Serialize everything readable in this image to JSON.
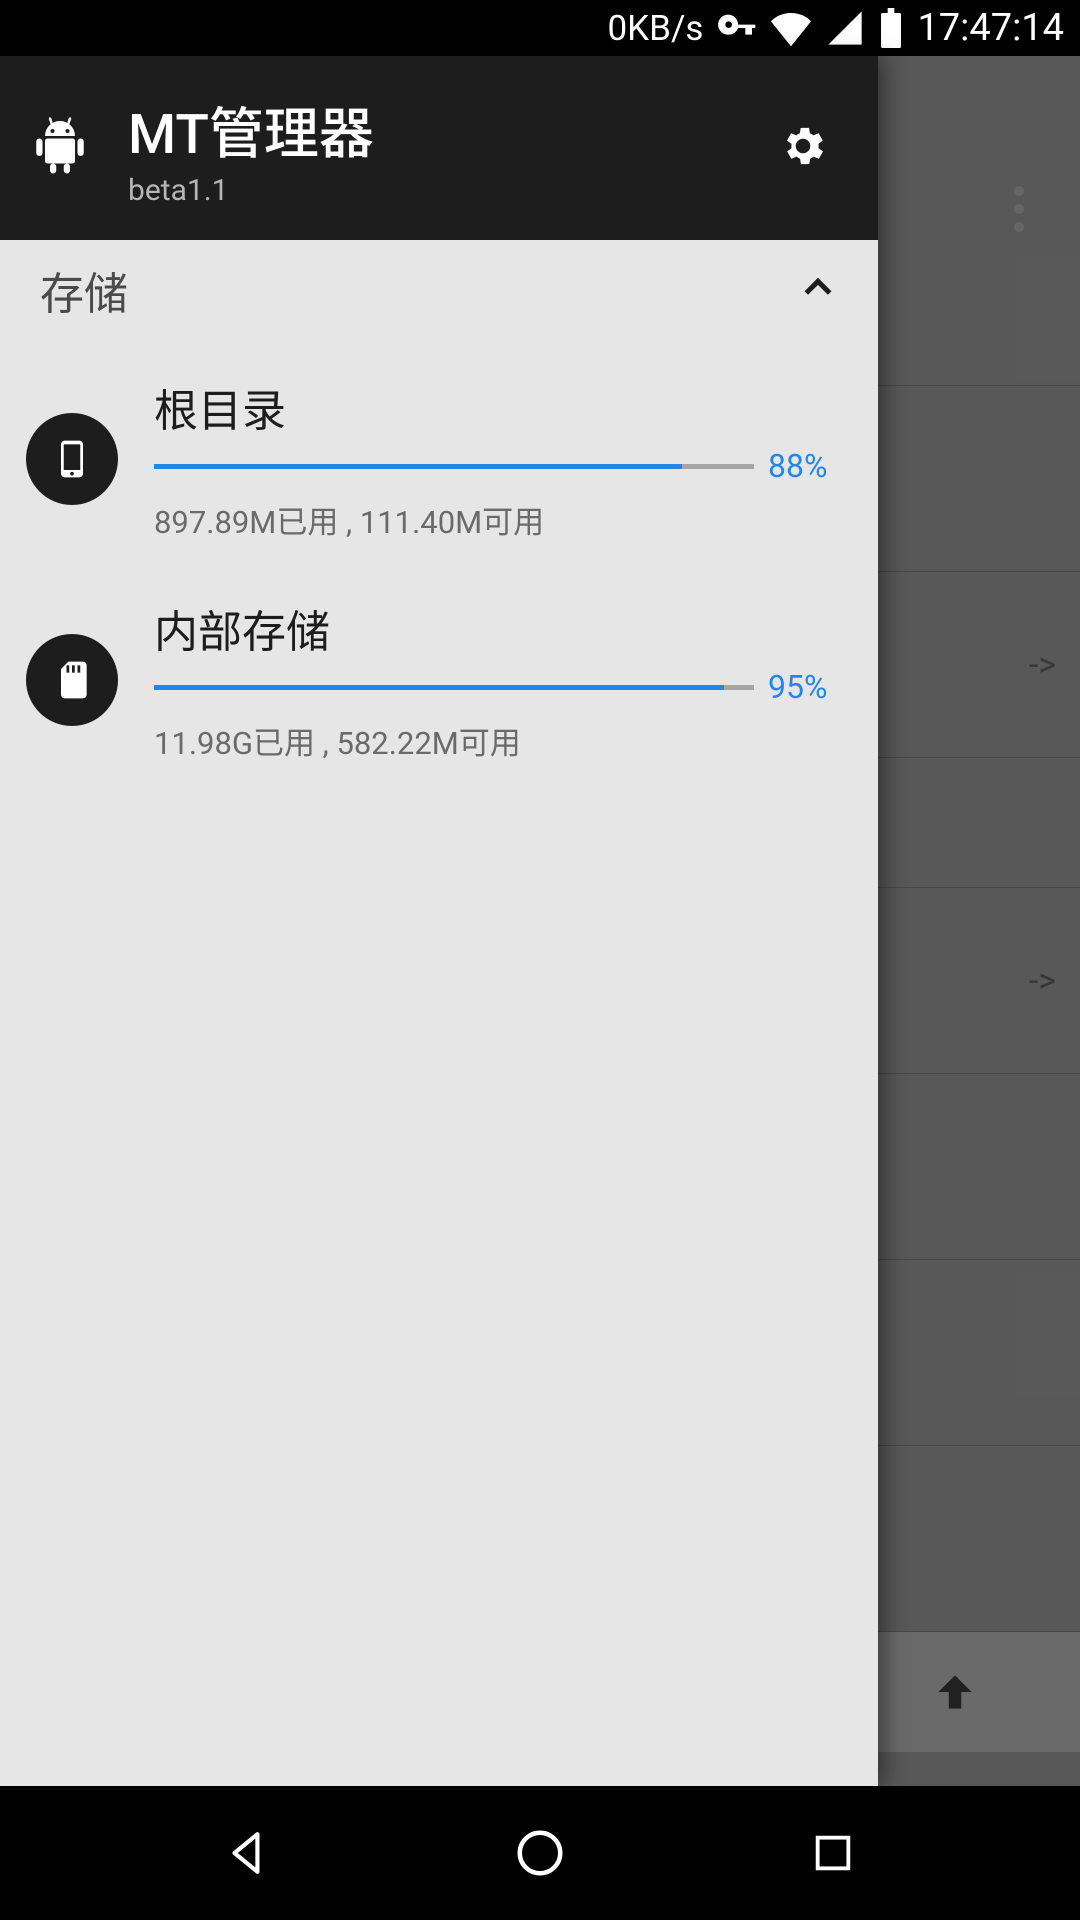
{
  "status": {
    "speed": "0KB/s",
    "time": "17:47:14"
  },
  "toolbar": {
    "title": "MT管理器",
    "subtitle": "beta1.1"
  },
  "section": {
    "title": "存储"
  },
  "storage": [
    {
      "title": "根目录",
      "percent": "88%",
      "percent_val": 88,
      "subtitle": "897.89M已用 , 111.40M可用"
    },
    {
      "title": "内部存储",
      "percent": "95%",
      "percent_val": 95,
      "subtitle": "11.98G已用 , 582.22M可用"
    }
  ],
  "bg": {
    "arrow1": "->",
    "arrow2": "->"
  }
}
